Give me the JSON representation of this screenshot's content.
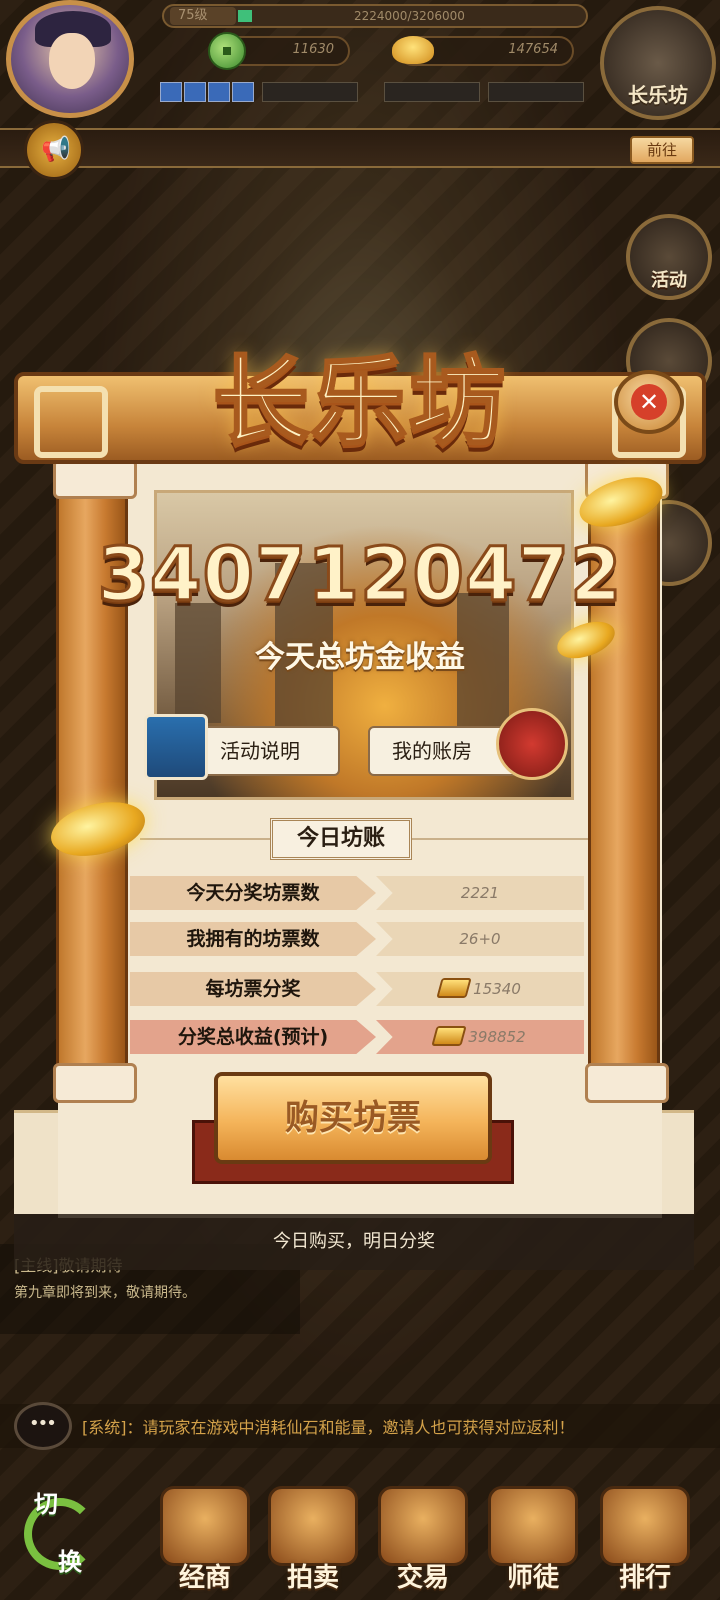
{
  "hud": {
    "level": "75级",
    "exp_text": "2224000/3206000",
    "coins": "11630",
    "gold": "147654",
    "map_label": "长乐坊"
  },
  "notice": {
    "goto_label": "前往"
  },
  "side_buttons": [
    "活动"
  ],
  "modal": {
    "title": "长乐坊",
    "total_earnings": "3407120472",
    "earnings_label": "今天总坊金收益",
    "info_button": "活动说明",
    "account_button": "我的账房",
    "ledger_title": "今日坊账",
    "rows": [
      {
        "name": "今天分奖坊票数",
        "value": "2221"
      },
      {
        "name": "我拥有的坊票数",
        "value": "26+0"
      },
      {
        "name": "每坊票分奖",
        "value": "15340"
      },
      {
        "name": "分奖总收益(预计)",
        "value": "398852"
      }
    ],
    "buy_button": "购买坊票",
    "footer_note": "今日购买，明日分奖"
  },
  "quest": {
    "title": "[主线]敬请期待",
    "desc": "第九章即将到来，敬请期待。"
  },
  "chat": {
    "text": "[系统]：请玩家在游戏中消耗仙石和能量，邀请人也可获得对应返利！"
  },
  "bottom_nav": {
    "swap_top": "切",
    "swap_bottom": "换",
    "items": [
      "经商",
      "拍卖",
      "交易",
      "师徒",
      "排行"
    ]
  },
  "colors": {
    "accent_gold": "#f4b45a",
    "panel_bg": "#f3e8d2",
    "highlight_row": "#e3a38c"
  }
}
